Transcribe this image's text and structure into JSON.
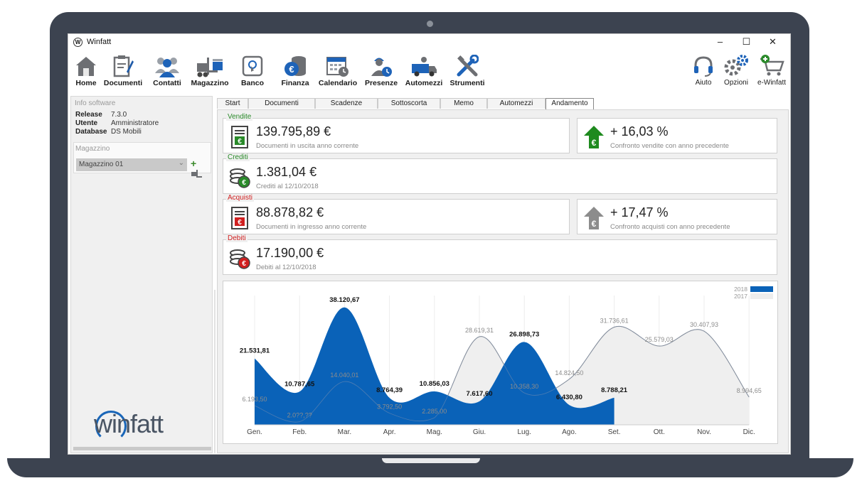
{
  "window": {
    "title": "Winfatt",
    "app_icon": "W",
    "minimize": "–",
    "maximize": "☐",
    "close": "✕"
  },
  "toolbar": {
    "items": [
      {
        "label": "Home",
        "icon": "home-icon"
      },
      {
        "label": "Documenti",
        "icon": "documents-icon"
      },
      {
        "label": "Contatti",
        "icon": "contacts-icon"
      },
      {
        "label": "Magazzino",
        "icon": "warehouse-icon"
      },
      {
        "label": "Banco",
        "icon": "pos-icon"
      },
      {
        "label": "Finanza",
        "icon": "finance-icon"
      },
      {
        "label": "Calendario",
        "icon": "calendar-icon"
      },
      {
        "label": "Presenze",
        "icon": "attendance-icon"
      },
      {
        "label": "Automezzi",
        "icon": "truck-icon"
      },
      {
        "label": "Strumenti",
        "icon": "tools-icon"
      }
    ],
    "right_items": [
      {
        "label": "Aiuto",
        "icon": "headset-icon"
      },
      {
        "label": "Opzioni",
        "icon": "gears-icon"
      },
      {
        "label": "e-Winfatt",
        "icon": "cart-icon"
      }
    ]
  },
  "sidebar": {
    "info_title": "Info software",
    "info": [
      {
        "key": "Release",
        "value": "7.3.0"
      },
      {
        "key": "Utente",
        "value": "Amministratore"
      },
      {
        "key": "Database",
        "value": "DS Mobili"
      }
    ],
    "magazzino_title": "Magazzino",
    "magazzino_selected": "Magazzino 01",
    "logo_text": "winfatt"
  },
  "tabs": [
    "Start",
    "Documenti",
    "Scadenze",
    "Sottoscorta",
    "Memo",
    "Automezzi",
    "Andamento"
  ],
  "active_tab": "Andamento",
  "cards": {
    "vendite": {
      "label": "Vendite",
      "value": "139.795,89 €",
      "sub": "Documenti in uscita anno corrente",
      "color": "#2a8a2a"
    },
    "vendite_trend": {
      "value": "+ 16,03 %",
      "sub": "Confronto vendite con anno precedente",
      "color": "#1e8a1e"
    },
    "crediti": {
      "label": "Crediti",
      "value": "1.381,04 €",
      "sub": "Crediti al 12/10/2018",
      "color": "#2a8a2a"
    },
    "acquisti": {
      "label": "Acquisti",
      "value": "88.878,82 €",
      "sub": "Documenti in ingresso anno corrente",
      "color": "#d02020"
    },
    "acquisti_trend": {
      "value": "+ 17,47 %",
      "sub": "Confronto acquisti con anno precedente",
      "color": "#8c8c8c"
    },
    "debiti": {
      "label": "Debiti",
      "value": "17.190,00 €",
      "sub": "Debiti al 12/10/2018",
      "color": "#d02020"
    }
  },
  "chart_data": {
    "type": "area",
    "categories": [
      "Gen.",
      "Feb.",
      "Mar.",
      "Apr.",
      "Mag.",
      "Giu.",
      "Lug.",
      "Ago.",
      "Set.",
      "Ott.",
      "Nov.",
      "Dic."
    ],
    "series": [
      {
        "name": "2018",
        "color": "#0a62b8",
        "values": [
          21531.81,
          10787.65,
          38120.67,
          8764.39,
          10856.03,
          7617.6,
          26898.73,
          6430.8,
          8788.21,
          null,
          null,
          null
        ],
        "labels": [
          "21.531,81",
          "10.787,65",
          "38.120,67",
          "8.764,39",
          "10.856,03",
          "7.617,60",
          "26.898,73",
          "6.430,80",
          "8.788,21",
          "",
          "",
          ""
        ]
      },
      {
        "name": "2017",
        "color": "#f0f0f0",
        "values": [
          6193.5,
          1000,
          14040.01,
          3792.5,
          2285.0,
          28619.31,
          10358.3,
          14824.5,
          31736.61,
          25579.03,
          30407.93,
          8994.65
        ],
        "labels": [
          "6.193,50",
          "2.0??,??",
          "14.040,01",
          "3.792,50",
          "2.285,00",
          "28.619,31",
          "10.358,30",
          "14.824,50",
          "31.736,61",
          "25.579,03",
          "30.407,93",
          "8.994,65"
        ]
      }
    ],
    "ylim": [
      0,
      42000
    ],
    "legend": "top-right",
    "grid": "vertical"
  }
}
